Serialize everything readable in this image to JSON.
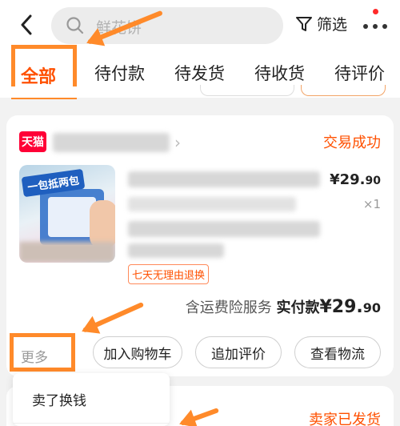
{
  "header": {
    "search_placeholder": "鲜花饼",
    "filter_label": "筛选"
  },
  "tabs": [
    {
      "label": "全部",
      "active": true
    },
    {
      "label": "待付款"
    },
    {
      "label": "待发货"
    },
    {
      "label": "待收货"
    },
    {
      "label": "待评价"
    }
  ],
  "order": {
    "shop_badge": "天猫",
    "status": "交易成功",
    "thumb_banner": "一包抵两包",
    "price_main": "¥29.",
    "price_decimal": "90",
    "quantity": "×1",
    "service_tag": "七天无理由退换",
    "shipping_note": "含运费险服务",
    "paid_label": "实付款",
    "paid_main": "¥29.",
    "paid_decimal": "90",
    "buttons": {
      "more": "更多",
      "add_cart": "加入购物车",
      "add_review": "追加评价",
      "track": "查看物流"
    }
  },
  "popup": {
    "item": "卖了换钱"
  },
  "next_order": {
    "status": "卖家已发货"
  },
  "colors": {
    "accent": "#ff5000",
    "highlight": "#ff8a2a",
    "tmall": "#ff0036"
  }
}
